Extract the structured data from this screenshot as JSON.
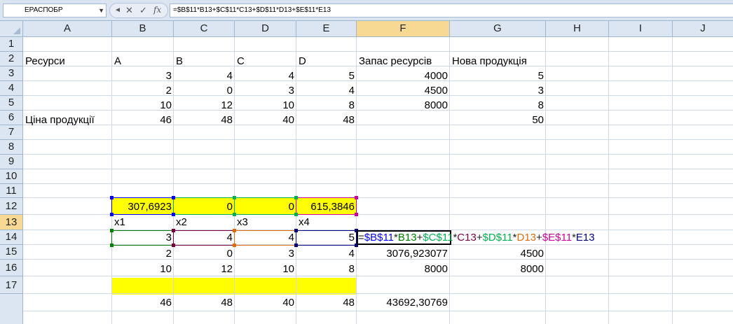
{
  "formula_bar": {
    "name_box": "ЕРАСПОБР",
    "cancel": "✕",
    "enter": "✓",
    "fx": "fx",
    "formula": "=$B$11*B13+$C$11*C13+$D$11*D13+$E$11*E13"
  },
  "columns": [
    "A",
    "B",
    "C",
    "D",
    "E",
    "F",
    "G",
    "H",
    "I",
    "J"
  ],
  "rows": [
    "1",
    "2",
    "3",
    "4",
    "5",
    "6",
    "7",
    "8",
    "9",
    "10",
    "11",
    "12",
    "13",
    "14",
    "15",
    "16",
    "17"
  ],
  "cells": {
    "A2": "Ресурси",
    "B2": "A",
    "C2": "B",
    "D2": "C",
    "E2": "D",
    "F2": "Запас ресурсів",
    "G2": "Нова продукція",
    "B3": "3",
    "C3": "4",
    "D3": "4",
    "E3": "5",
    "F3": "4000",
    "G3": "5",
    "B4": "2",
    "C4": "0",
    "D4": "3",
    "E4": "4",
    "F4": "4500",
    "G4": "3",
    "B5": "10",
    "C5": "12",
    "D5": "10",
    "E5": "8",
    "F5": "8000",
    "G5": "8",
    "A6": "Ціна продукції",
    "B6": "46",
    "C6": "48",
    "D6": "40",
    "E6": "48",
    "G6": "50",
    "B11": "307,6923",
    "C11": "0",
    "D11": "0",
    "E11": "615,3846",
    "B12": "x1",
    "C12": "x2",
    "D12": "x3",
    "E12": "x4",
    "B13": "3",
    "C13": "4",
    "D13": "4",
    "E13": "5",
    "B14": "2",
    "C14": "0",
    "D14": "3",
    "E14": "4",
    "F14": "3076,923077",
    "G14": "4500",
    "B15": "10",
    "C15": "12",
    "D15": "10",
    "E15": "8",
    "F15": "8000",
    "G15": "8000",
    "B17": "46",
    "C17": "48",
    "D17": "40",
    "E17": "48",
    "F17": "43692,30769"
  },
  "editing": {
    "cell": "F13",
    "parts": [
      "=",
      "$B$11",
      "*",
      "B13",
      "+",
      "$C$11",
      "*",
      "C13",
      "+",
      "$D$11",
      "*",
      "D13",
      "+",
      "$E$11",
      "*",
      "E13"
    ]
  },
  "colors": {
    "highlight": "#ffff00",
    "ref_blue": "#0000ff",
    "ref_green": "#008000",
    "ref_maroon": "#7a0040",
    "ref_orange": "#e26b0a",
    "ref_magenta": "#cc0099",
    "selected_header": "#f8d994"
  }
}
